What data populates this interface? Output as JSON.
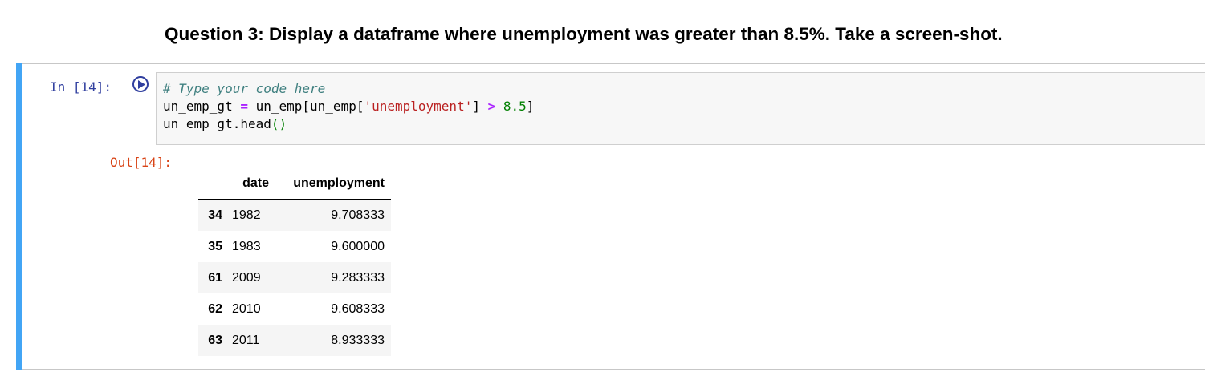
{
  "heading": "Question 3: Display a dataframe where unemployment was greater than 8.5%. Take a screen-shot.",
  "cell": {
    "in_prompt": "In [14]:",
    "out_prompt": "Out[14]:",
    "run_icon": "play-circle-icon",
    "code": {
      "comment": "# Type your code here",
      "line2_a": "un_emp_gt ",
      "line2_eq": "=",
      "line2_b": " un_emp[un_emp[",
      "line2_str": "'unemployment'",
      "line2_c": "] ",
      "line2_op": ">",
      "line2_sp": " ",
      "line2_num": "8.5",
      "line2_d": "]",
      "line3_a": "un_emp_gt.head",
      "line3_paren": "()"
    }
  },
  "dataframe": {
    "columns": [
      "",
      "date",
      "unemployment"
    ],
    "rows": [
      {
        "index": "34",
        "date": "1982",
        "unemployment": "9.708333"
      },
      {
        "index": "35",
        "date": "1983",
        "unemployment": "9.600000"
      },
      {
        "index": "61",
        "date": "2009",
        "unemployment": "9.283333"
      },
      {
        "index": "62",
        "date": "2010",
        "unemployment": "9.608333"
      },
      {
        "index": "63",
        "date": "2011",
        "unemployment": "8.933333"
      }
    ]
  },
  "colors": {
    "cell_selected_bar": "#42a5f5",
    "in_prompt": "#303f9f",
    "out_prompt": "#d84315",
    "code_bg": "#f7f7f7"
  }
}
